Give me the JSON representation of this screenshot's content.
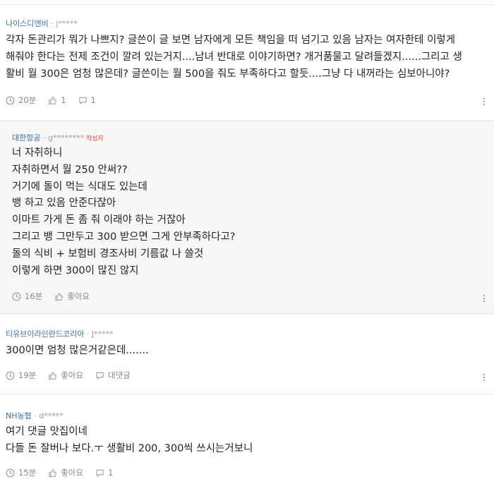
{
  "comments": [
    {
      "company": "나이스디앤비",
      "user": "j*****",
      "lines": [
        "각자 돈관리가 뭐가 나쁘지? 글쓴이 글 보면 남자에게 모든 책임을 떠 넘기고 있음 남자는 여자한테 이렇게",
        "해줘야 한다는 전제 조건이 깔려 있는거지....남녀 반대로 이야기하면? 개거품물고 달려들겠지......그리고 생",
        "활비 월 300은 엄청 많은데? 글쓴이는 월 500을 줘도 부족하다고 할듯....그냥 다 내꺼라는 심보아니야?"
      ],
      "time": "20분",
      "likes": "1",
      "replies": "1"
    },
    {
      "company": "대한항공",
      "user": "g********",
      "badge": "작성자",
      "lines": [
        "너 자취하니",
        "자취하면서 월 250 안써??",
        "거기에 돌이 먹는 식대도 있는데",
        "뱅 하고 있음 안준다잖아",
        "이마트 가게 돈 좀 줘 이래야 하는 거잖아",
        "그리고 뱅 그만두고 300 받으면 그게 안부족하다고?",
        "돌의 식비 + 보험비 경조사비 기름값 나 쓸것",
        "이렇게 하면 300이 많진 않지"
      ],
      "time": "16분",
      "likes": "좋아요"
    },
    {
      "company": "티유브이라인란드코리아",
      "user": "J*****",
      "lines": [
        "300이면 엄청 많은거같은데......."
      ],
      "time": "19분",
      "likes": "좋아요",
      "replies": "대댓글"
    },
    {
      "company": "NH농협",
      "user": "d*****",
      "lines": [
        "여기 댓글 맛집이네",
        "다들 돈 잘버나 보다.ㅜ 생활비 200, 300씩 쓰시는거보니"
      ],
      "time": "15분",
      "likes": "좋아요",
      "replies": "1"
    }
  ]
}
